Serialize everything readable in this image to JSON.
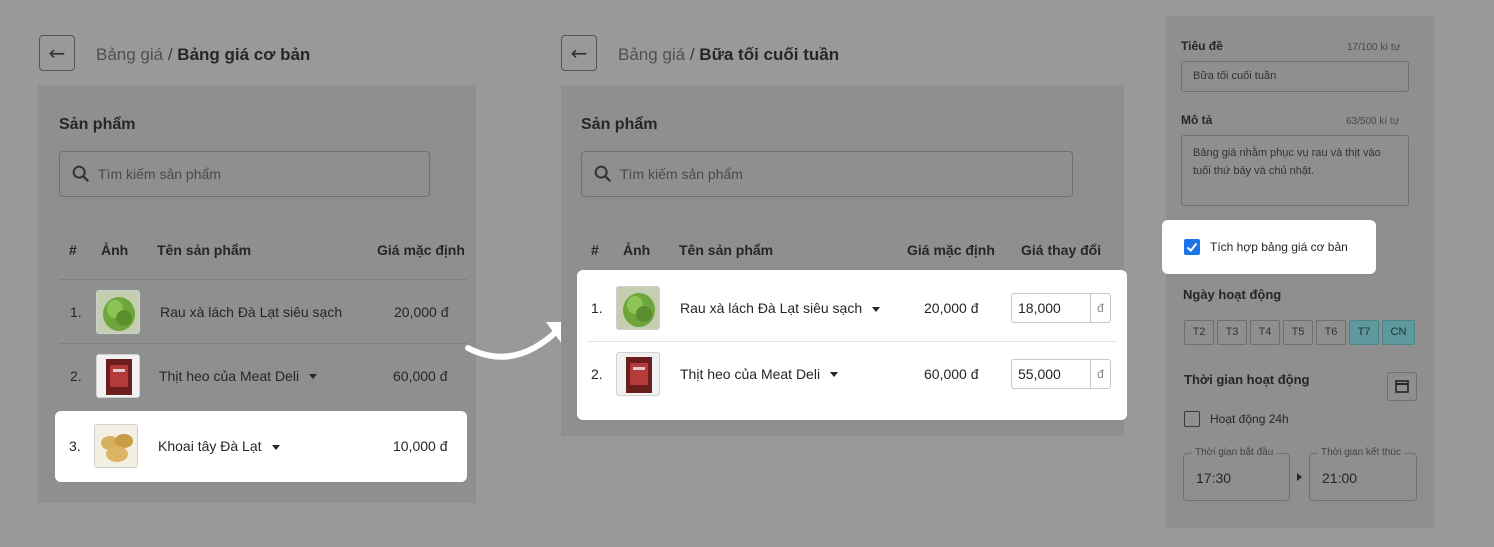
{
  "left": {
    "breadcrumb_parent": "Bảng giá",
    "breadcrumb_sep": " / ",
    "breadcrumb_current": "Bảng giá cơ bản",
    "section_title": "Sản phẩm",
    "search_placeholder": "Tìm kiếm sản phẩm",
    "headers": {
      "num": "#",
      "image": "Ảnh",
      "name": "Tên sản phẩm",
      "default_price": "Giá mặc định"
    },
    "rows": [
      {
        "num": "1.",
        "name": "Rau xà lách Đà Lạt siêu sạch",
        "price": "20,000 đ",
        "thumb": "lettuce"
      },
      {
        "num": "2.",
        "name": "Thịt heo của Meat Deli",
        "price": "60,000 đ",
        "thumb": "meat-package"
      },
      {
        "num": "3.",
        "name": "Khoai tây Đà Lạt",
        "price": "10,000 đ",
        "thumb": "potatoes"
      }
    ]
  },
  "middle": {
    "breadcrumb_parent": "Bảng giá",
    "breadcrumb_sep": " / ",
    "breadcrumb_current": "Bữa tối cuối tuần",
    "section_title": "Sản phẩm",
    "search_placeholder": "Tìm kiếm sản phẩm",
    "headers": {
      "num": "#",
      "image": "Ảnh",
      "name": "Tên sản phẩm",
      "default_price": "Giá mặc định",
      "changed_price": "Giá thay đổi"
    },
    "rows": [
      {
        "num": "1.",
        "name": "Rau xà lách Đà Lạt siêu sạch",
        "price": "20,000 đ",
        "new_price": "18,000",
        "currency": "đ",
        "thumb": "lettuce"
      },
      {
        "num": "2.",
        "name": "Thịt heo của Meat Deli",
        "price": "60,000 đ",
        "new_price": "55,000",
        "currency": "đ",
        "thumb": "meat-package"
      }
    ]
  },
  "panel": {
    "title_label": "Tiêu đề",
    "title_count": "17/100 kí tự",
    "title_value": "Bữa tối cuối tuần",
    "desc_label": "Mô tả",
    "desc_count": "63/500 kí tự",
    "desc_line1": "Bảng giá nhằm phục vụ rau và thịt vào",
    "desc_line2": "tuối thứ bảy và chủ nhật.",
    "integrate_label": "Tích hợp bảng giá cơ bản",
    "integrate_checked": true,
    "days_label": "Ngày hoạt động",
    "days": [
      {
        "label": "T2",
        "active": false
      },
      {
        "label": "T3",
        "active": false
      },
      {
        "label": "T4",
        "active": false
      },
      {
        "label": "T5",
        "active": false
      },
      {
        "label": "T6",
        "active": false
      },
      {
        "label": "T7",
        "active": true
      },
      {
        "label": "CN",
        "active": true
      }
    ],
    "time_label": "Thời gian hoạt động",
    "all_day_label": "Hoạt động 24h",
    "all_day_checked": false,
    "start_label": "Thời gian bắt đầu",
    "start_value": "17:30",
    "end_label": "Thời gian kết thúc",
    "end_value": "21:00"
  },
  "colors": {
    "accent": "#1a73e8",
    "day_active": "#5e999d",
    "overlay": "#999999"
  }
}
